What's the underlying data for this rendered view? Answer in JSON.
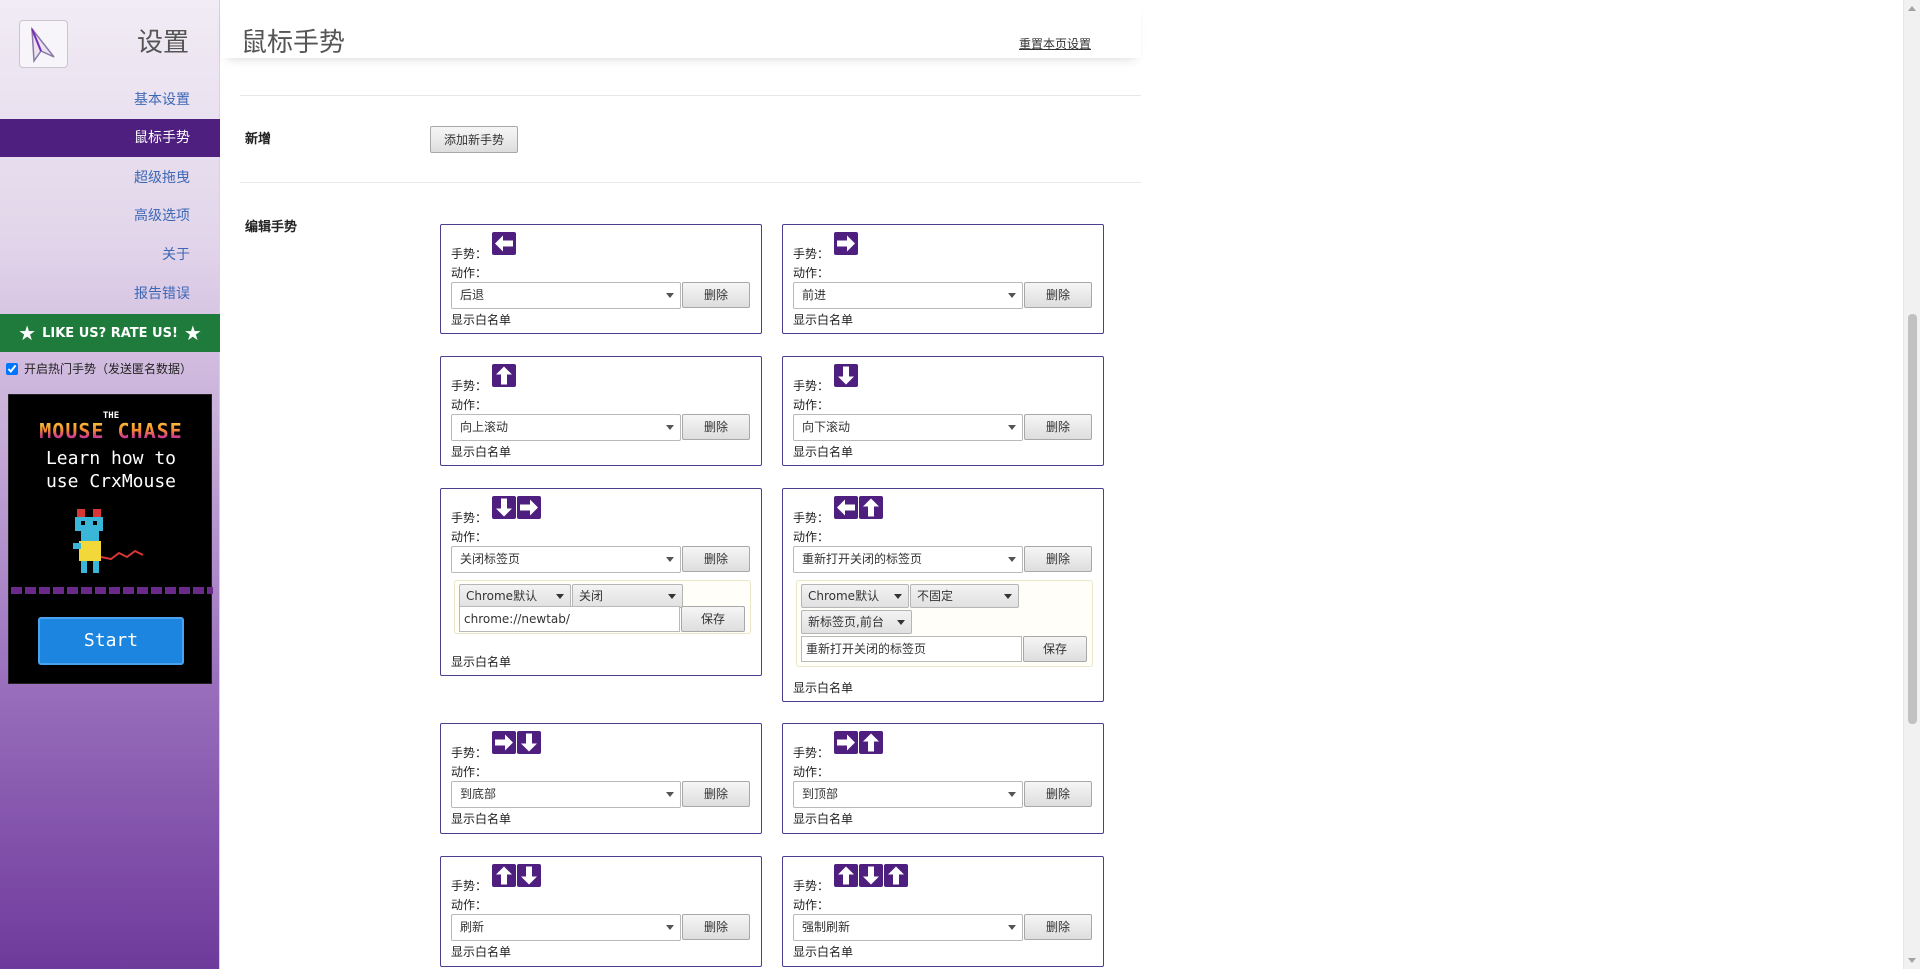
{
  "sidebar": {
    "title": "设置",
    "items": [
      {
        "label": "基本设置",
        "active": false
      },
      {
        "label": "鼠标手势",
        "active": true
      },
      {
        "label": "超级拖曳",
        "active": false
      },
      {
        "label": "高级选项",
        "active": false
      },
      {
        "label": "关于",
        "active": false
      },
      {
        "label": "报告错误",
        "active": false
      }
    ],
    "rate_label": "LIKE US? RATE US!",
    "hot_gesture_label": "开启热门手势（发送匿名数据）",
    "hot_gesture_checked": true,
    "promo": {
      "the": "THE",
      "title": "MOUSE CHASE",
      "line1": "Learn how to",
      "line2": "use CrxMouse",
      "button": "Start"
    }
  },
  "header": {
    "title": "鼠标手势",
    "reset_link": "重置本页设置"
  },
  "sections": {
    "add_label": "新增",
    "add_button": "添加新手势",
    "edit_label": "编辑手势"
  },
  "card_labels": {
    "gesture": "手势：",
    "action": "动作：",
    "delete": "删除",
    "whitelist": "显示白名单",
    "save": "保存"
  },
  "gestures": [
    {
      "arrows": [
        "left"
      ],
      "action": "后退"
    },
    {
      "arrows": [
        "right"
      ],
      "action": "前进"
    },
    {
      "arrows": [
        "up"
      ],
      "action": "向上滚动"
    },
    {
      "arrows": [
        "down"
      ],
      "action": "向下滚动"
    },
    {
      "arrows": [
        "down",
        "right"
      ],
      "action": "关闭标签页",
      "options": {
        "select1": "Chrome默认",
        "select2": "关闭",
        "url": "chrome://newtab/"
      }
    },
    {
      "arrows": [
        "left",
        "up"
      ],
      "action": "重新打开关闭的标签页",
      "options": {
        "select1": "Chrome默认",
        "select2": "不固定",
        "select3": "新标签页,前台",
        "text": "重新打开关闭的标签页"
      }
    },
    {
      "arrows": [
        "right",
        "down"
      ],
      "action": "到底部"
    },
    {
      "arrows": [
        "right",
        "up"
      ],
      "action": "到顶部"
    },
    {
      "arrows": [
        "up",
        "down"
      ],
      "action": "刷新"
    },
    {
      "arrows": [
        "up",
        "down",
        "up"
      ],
      "action": "强制刷新"
    }
  ],
  "colors": {
    "accent_purple": "#4e1f7e",
    "rate_green": "#1f7b3b",
    "nav_link": "#3d68b5",
    "card_border": "#4a3f8f"
  }
}
